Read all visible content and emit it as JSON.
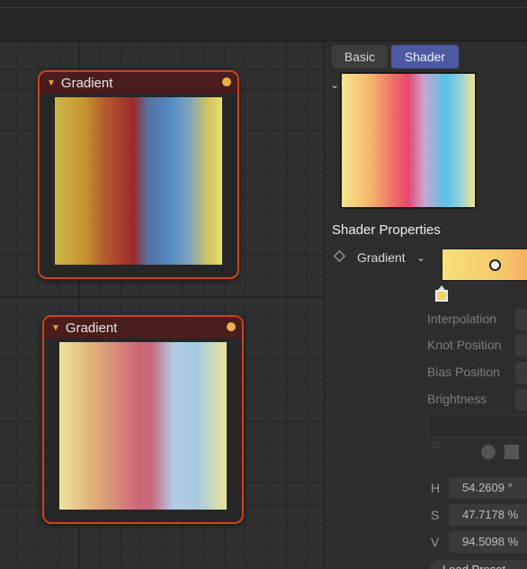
{
  "nodes": [
    {
      "title": "Gradient"
    },
    {
      "title": "Gradient"
    }
  ],
  "panel": {
    "tabs": [
      {
        "label": "Basic",
        "active": false
      },
      {
        "label": "Shader",
        "active": true
      }
    ],
    "section_title": "Shader Properties",
    "property": {
      "label": "Gradient"
    },
    "fields": [
      "Interpolation",
      "Knot Position",
      "Bias Position",
      "Brightness"
    ],
    "hsv": [
      {
        "label": "H",
        "value": "54.2609 °"
      },
      {
        "label": "S",
        "value": "47.7178 %"
      },
      {
        "label": "V",
        "value": "94.5098 %"
      }
    ],
    "bottom_button": "Load Preset"
  },
  "colors": {
    "node_border": "#c9451f",
    "node_header": "#4a1c1c",
    "tab_active": "#4d5aa3",
    "socket": "#e8b04a",
    "ramp_stop": "#f3d261"
  }
}
